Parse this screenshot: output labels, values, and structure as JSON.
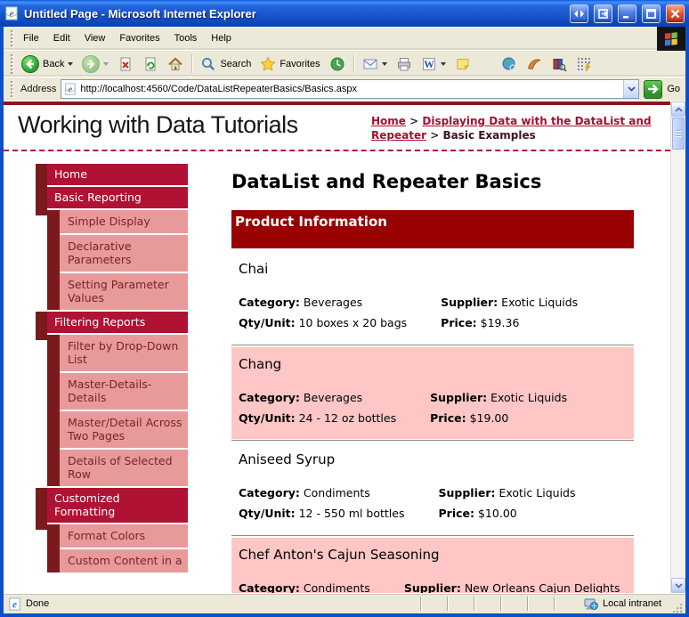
{
  "window": {
    "title": "Untitled Page - Microsoft Internet Explorer"
  },
  "menu": {
    "items": [
      "File",
      "Edit",
      "View",
      "Favorites",
      "Tools",
      "Help"
    ]
  },
  "toolbar": {
    "back": "Back",
    "search": "Search",
    "favorites": "Favorites"
  },
  "address": {
    "label": "Address",
    "url": "http://localhost:4560/Code/DataListRepeaterBasics/Basics.aspx",
    "go": "Go"
  },
  "header": {
    "site_title": "Working with Data Tutorials",
    "breadcrumb": {
      "link1": "Home",
      "sep": ">",
      "link2": "Displaying Data with the DataList and Repeater",
      "current": "Basic Examples"
    }
  },
  "sidebar": {
    "items": [
      {
        "label": "Home",
        "level": 1
      },
      {
        "label": "Basic Reporting",
        "level": 1
      },
      {
        "label": "Simple Display",
        "level": 2
      },
      {
        "label": "Declarative Parameters",
        "level": 2
      },
      {
        "label": "Setting Parameter Values",
        "level": 2
      },
      {
        "label": "Filtering Reports",
        "level": 1
      },
      {
        "label": "Filter by Drop-Down List",
        "level": 2
      },
      {
        "label": "Master-Details-Details",
        "level": 2
      },
      {
        "label": "Master/Detail Across Two Pages",
        "level": 2
      },
      {
        "label": "Details of Selected Row",
        "level": 2
      },
      {
        "label": "Customized Formatting",
        "level": 1
      },
      {
        "label": "Format Colors",
        "level": 2
      },
      {
        "label": "Custom Content in a",
        "level": 2
      }
    ]
  },
  "main": {
    "page_title": "DataList and Repeater Basics",
    "banner": "Product Information",
    "field_labels": {
      "category": "Category:",
      "supplier": "Supplier:",
      "qty": "Qty/Unit:",
      "price": "Price:"
    },
    "products": [
      {
        "name": "Chai",
        "category": "Beverages",
        "supplier": "Exotic Liquids",
        "qty": "10 boxes x 20 bags",
        "price": "$19.36",
        "alt": false
      },
      {
        "name": "Chang",
        "category": "Beverages",
        "supplier": "Exotic Liquids",
        "qty": "24 - 12 oz bottles",
        "price": "$19.00",
        "alt": true
      },
      {
        "name": "Aniseed Syrup",
        "category": "Condiments",
        "supplier": "Exotic Liquids",
        "qty": "12 - 550 ml bottles",
        "price": "$10.00",
        "alt": false
      },
      {
        "name": "Chef Anton's Cajun Seasoning",
        "category": "Condiments",
        "supplier": "New Orleans Cajun Delights",
        "alt": true
      }
    ]
  },
  "status": {
    "left": "Done",
    "right": "Local intranet"
  },
  "colors": {
    "crimson_menu": "#B01234",
    "dark_maroon": "#7B1A1C",
    "sidebar_pink": "#E89A9A",
    "banner_red": "#990000",
    "item_alt_pink": "#FFC6C6",
    "link_red": "#A3112F",
    "chrome": "#ECE9D8",
    "titlebar_blue": "#1653D6"
  },
  "icons": {
    "ie_logo": "blue italic e with gold orbit",
    "back": "green circle left arrow",
    "forward": "green circle right arrow disabled",
    "stop": "document with red x",
    "refresh": "document with green circular arrows",
    "home": "house",
    "search": "magnifier",
    "favorites": "gold star",
    "history": "green clock circle",
    "mail": "envelope",
    "print": "printer",
    "edit_word": "boxed blue W",
    "notes": "yellow sticky note",
    "msn": "blue-green globe",
    "messenger": "orange swoosh figure",
    "media": "books with magnifier",
    "scripts": "script grid with bolt",
    "go": "green square white arrow",
    "windows_flag": "four color windows flag",
    "local_intranet": "computer with globe",
    "resize_grip": "diagonal dots"
  }
}
